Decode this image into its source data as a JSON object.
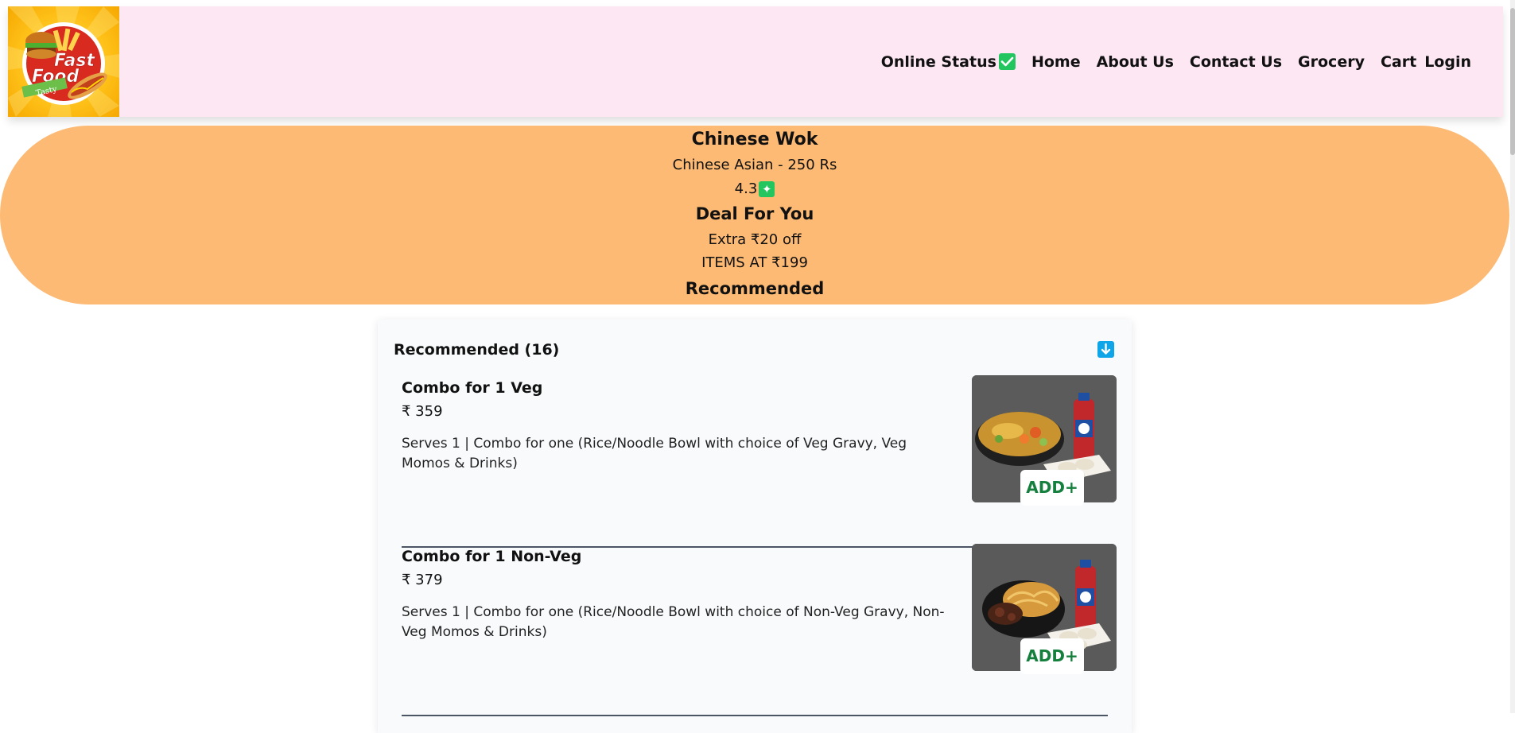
{
  "header": {
    "logo_text": "Fast Food Tasty",
    "nav": {
      "online_status": "Online Status",
      "home": "Home",
      "about": "About Us",
      "contact": "Contact Us",
      "grocery": "Grocery",
      "cart": "Cart",
      "login": "Login"
    },
    "online_icon": "check-icon",
    "status_color": "#22c55e"
  },
  "restaurant": {
    "name": "Chinese Wok",
    "cuisine_price": "Chinese Asian - 250 Rs",
    "rating": "4.3",
    "rating_icon": "sparkle-star-icon",
    "deal_title": "Deal For You",
    "deal_line_1": "Extra ₹20 off",
    "deal_line_2": "ITEMS AT ₹199",
    "section_title": "Recommended"
  },
  "menu": {
    "category_title": "Recommended (16)",
    "toggle_icon": "arrow-down-icon",
    "items": [
      {
        "name": "Combo for 1 Veg",
        "price": "₹ 359",
        "description": "Serves 1 | Combo for one (Rice/Noodle Bowl with choice of Veg Gravy, Veg Momos & Drinks)",
        "add_label": "ADD+"
      },
      {
        "name": "Combo for 1 Non-Veg",
        "price": "₹ 379",
        "description": "Serves 1 | Combo for one (Rice/Noodle Bowl with choice of Non-Veg Gravy, Non- Veg Momos & Drinks)",
        "add_label": "ADD+"
      }
    ]
  },
  "colors": {
    "header_bg": "#fce7f3",
    "hero_bg": "#fdba74",
    "add_text": "#15803d",
    "accordion_icon": "#0ea5e9"
  }
}
